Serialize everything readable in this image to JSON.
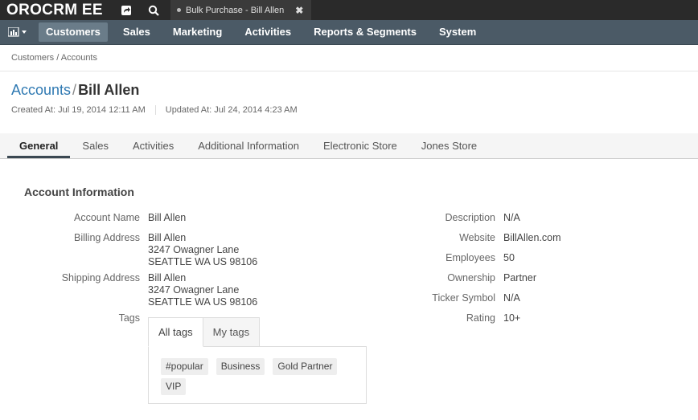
{
  "app": {
    "logo": "OROCRM EE"
  },
  "topbar": {
    "icons": [
      "share-icon",
      "search-icon"
    ],
    "pinned_tab": "Bulk Purchase - Bill Allen",
    "pinned_close": "✖"
  },
  "nav": {
    "items": [
      {
        "label": "Customers",
        "active": true
      },
      {
        "label": "Sales"
      },
      {
        "label": "Marketing"
      },
      {
        "label": "Activities"
      },
      {
        "label": "Reports & Segments"
      },
      {
        "label": "System"
      }
    ]
  },
  "breadcrumb": "Customers / Accounts",
  "page": {
    "crumb": "Accounts",
    "separator": "/",
    "title": "Bill Allen",
    "created": "Created At: Jul 19, 2014 12:11 AM",
    "updated": "Updated At: Jul 24, 2014 4:23 AM"
  },
  "tabs": [
    "General",
    "Sales",
    "Activities",
    "Additional Information",
    "Electronic Store",
    "Jones Store"
  ],
  "section": {
    "title": "Account Information",
    "left": {
      "account_name_label": "Account Name",
      "account_name": "Bill Allen",
      "billing_label": "Billing Address",
      "billing": [
        "Bill Allen",
        "3247 Owagner Lane",
        "SEATTLE WA US 98106"
      ],
      "shipping_label": "Shipping Address",
      "shipping": [
        "Bill Allen",
        "3247 Owagner Lane",
        "SEATTLE WA US 98106"
      ],
      "tags_label": "Tags"
    },
    "right": {
      "description_label": "Description",
      "description": "N/A",
      "website_label": "Website",
      "website": "BillAllen.com",
      "employees_label": "Employees",
      "employees": "50",
      "ownership_label": "Ownership",
      "ownership": "Partner",
      "ticker_label": "Ticker Symbol",
      "ticker": "N/A",
      "rating_label": "Rating",
      "rating": "10+"
    }
  },
  "tags": {
    "tabs": [
      "All tags",
      "My tags"
    ],
    "items": [
      "#popular",
      "Business",
      "Gold Partner",
      "VIP"
    ]
  }
}
